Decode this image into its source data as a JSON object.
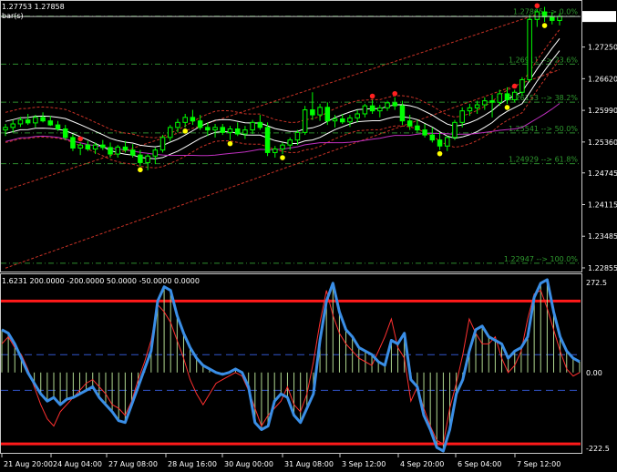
{
  "colors": {
    "background": "#000000",
    "frame": "#c8c8c8",
    "candle_up": "#00ff00",
    "candle_down_fill": "#000000",
    "fib_line": "#2e8b2e",
    "ma_white": "#ffffff",
    "envelope_red": "#c83226",
    "ma_magenta": "#c030c0",
    "trend_red": "#c83226",
    "signal_red": "#ff2020",
    "signal_yellow": "#ffff00",
    "cci_line": "#3a8ee6",
    "cci_signal": "#ff3030",
    "cci_hist": "#b0d890",
    "cci_level_red": "#ff1a1a",
    "cci_dash": "#3355cc",
    "price_box_bg": "#ffffff",
    "price_box_fg": "#000000"
  },
  "header": {
    "price_line": "1.27753 1.27858",
    "sub_label": "bar(s)"
  },
  "current_price": {
    "value": 1.27858,
    "label": "1.27858"
  },
  "price_axis": {
    "min": 1.228,
    "max": 1.2815,
    "ticks": [
      "1.27250",
      "1.26620",
      "1.25990",
      "1.25360",
      "1.24745",
      "1.24115",
      "1.23485",
      "1.22855"
    ],
    "tick_values": [
      1.2725,
      1.2662,
      1.2599,
      1.2536,
      1.24745,
      1.24115,
      1.23485,
      1.22855
    ]
  },
  "fib_levels": [
    {
      "price": 1.27865,
      "label": "1.27865 --> 0.0%"
    },
    {
      "price": 1.26911,
      "label": "1.26911 --> 23.6%"
    },
    {
      "price": 1.26153,
      "label": "1.26153 --> 38.2%"
    },
    {
      "price": 1.25541,
      "label": "1.25541 --> 50.0%"
    },
    {
      "price": 1.24929,
      "label": "1.24929 --> 61.8%"
    },
    {
      "price": 1.22947,
      "label": "1.22947 --> 100.0%"
    }
  ],
  "indicator": {
    "header": "1.6231 200.0000 -200.0000 50.0000 -50.0000 0.0000",
    "axis": {
      "min": -222.5,
      "max": 272.5,
      "ticks": [
        "272.5",
        "0.00",
        "-222.5"
      ],
      "tick_values": [
        272.5,
        0,
        -222.5
      ]
    },
    "levels_red": [
      200,
      -200
    ],
    "levels_dash": [
      50,
      -50
    ],
    "cci": [
      120,
      110,
      80,
      40,
      0,
      -30,
      -60,
      -80,
      -70,
      -90,
      -75,
      -70,
      -60,
      -50,
      -40,
      -70,
      -90,
      -110,
      -135,
      -140,
      -90,
      -40,
      10,
      60,
      200,
      240,
      230,
      160,
      110,
      70,
      40,
      20,
      10,
      0,
      -5,
      0,
      10,
      0,
      -40,
      -140,
      -160,
      -150,
      -80,
      -60,
      -70,
      -120,
      -140,
      -100,
      -60,
      90,
      200,
      250,
      170,
      120,
      100,
      70,
      60,
      50,
      30,
      20,
      90,
      80,
      110,
      -20,
      -40,
      -120,
      -160,
      -210,
      -220,
      -160,
      -60,
      -20,
      60,
      120,
      130,
      100,
      90,
      80,
      40,
      60,
      70,
      100,
      210,
      250,
      260,
      170,
      100,
      60,
      40,
      30
    ],
    "signal": [
      80,
      100,
      70,
      50,
      10,
      -40,
      -90,
      -130,
      -150,
      -110,
      -90,
      -70,
      -50,
      -30,
      -20,
      -40,
      -60,
      -90,
      -100,
      -120,
      -80,
      -20,
      30,
      90,
      190,
      170,
      140,
      90,
      40,
      -20,
      -60,
      -90,
      -60,
      -30,
      -20,
      -10,
      0,
      -10,
      -50,
      -100,
      -150,
      -120,
      -100,
      -80,
      -40,
      -90,
      -110,
      -60,
      30,
      140,
      230,
      160,
      110,
      80,
      60,
      40,
      30,
      20,
      60,
      100,
      150,
      70,
      40,
      -80,
      -40,
      -100,
      -150,
      -190,
      -200,
      -100,
      -30,
      50,
      150,
      110,
      80,
      80,
      100,
      40,
      0,
      20,
      60,
      150,
      220,
      230,
      180,
      120,
      60,
      10,
      -10,
      0
    ]
  },
  "time_axis": {
    "labels": [
      "21 Aug 20:00",
      "24 Aug 04:00",
      "27 Aug 08:00",
      "28 Aug 16:00",
      "30 Aug 00:00",
      "31 Aug 08:00",
      "3 Sep 12:00",
      "4 Sep 20:00",
      "6 Sep 04:00",
      "7 Sep 12:00"
    ]
  },
  "chart_data": {
    "type": "candlestick",
    "title": "",
    "ylim": [
      1.228,
      1.2815
    ],
    "candles": [
      [
        1.256,
        1.2572,
        1.2548,
        1.2565
      ],
      [
        1.2565,
        1.258,
        1.2555,
        1.2572
      ],
      [
        1.2572,
        1.2586,
        1.2566,
        1.258
      ],
      [
        1.258,
        1.2592,
        1.257,
        1.2574
      ],
      [
        1.2574,
        1.259,
        1.2565,
        1.2585
      ],
      [
        1.2585,
        1.2595,
        1.2575,
        1.2578
      ],
      [
        1.2578,
        1.2588,
        1.2568,
        1.257
      ],
      [
        1.257,
        1.2578,
        1.2558,
        1.2562
      ],
      [
        1.2562,
        1.257,
        1.254,
        1.2545
      ],
      [
        1.2545,
        1.2552,
        1.2518,
        1.2524
      ],
      [
        1.2524,
        1.2535,
        1.251,
        1.253
      ],
      [
        1.253,
        1.2538,
        1.2518,
        1.2522
      ],
      [
        1.2522,
        1.2535,
        1.2512,
        1.253
      ],
      [
        1.253,
        1.254,
        1.252,
        1.2525
      ],
      [
        1.2525,
        1.2535,
        1.2505,
        1.2512
      ],
      [
        1.2512,
        1.253,
        1.2505,
        1.2526
      ],
      [
        1.2526,
        1.2538,
        1.2515,
        1.252
      ],
      [
        1.252,
        1.2532,
        1.2505,
        1.251
      ],
      [
        1.251,
        1.252,
        1.2488,
        1.2495
      ],
      [
        1.2495,
        1.2512,
        1.248,
        1.2508
      ],
      [
        1.2508,
        1.2525,
        1.2492,
        1.252
      ],
      [
        1.252,
        1.255,
        1.2515,
        1.2545
      ],
      [
        1.2545,
        1.257,
        1.2538,
        1.2565
      ],
      [
        1.2565,
        1.2582,
        1.2555,
        1.2575
      ],
      [
        1.2575,
        1.2592,
        1.2565,
        1.2585
      ],
      [
        1.2585,
        1.26,
        1.257,
        1.2578
      ],
      [
        1.2578,
        1.259,
        1.256,
        1.2565
      ],
      [
        1.2565,
        1.2575,
        1.2548,
        1.256
      ],
      [
        1.256,
        1.2572,
        1.2545,
        1.2565
      ],
      [
        1.2565,
        1.2572,
        1.255,
        1.2555
      ],
      [
        1.2555,
        1.2568,
        1.254,
        1.2562
      ],
      [
        1.2562,
        1.2575,
        1.2548,
        1.2552
      ],
      [
        1.2552,
        1.2568,
        1.2542,
        1.256
      ],
      [
        1.256,
        1.258,
        1.2552,
        1.2575
      ],
      [
        1.2575,
        1.259,
        1.256,
        1.2565
      ],
      [
        1.2565,
        1.2575,
        1.2508,
        1.2515
      ],
      [
        1.2515,
        1.2528,
        1.2505,
        1.2522
      ],
      [
        1.2522,
        1.2535,
        1.2512,
        1.253
      ],
      [
        1.253,
        1.2545,
        1.252,
        1.254
      ],
      [
        1.254,
        1.256,
        1.253,
        1.2555
      ],
      [
        1.2555,
        1.2608,
        1.255,
        1.26
      ],
      [
        1.26,
        1.2635,
        1.258,
        1.259
      ],
      [
        1.259,
        1.2612,
        1.2578,
        1.2605
      ],
      [
        1.2605,
        1.2615,
        1.257,
        1.2578
      ],
      [
        1.2578,
        1.259,
        1.2565,
        1.2582
      ],
      [
        1.2582,
        1.2592,
        1.2572,
        1.2576
      ],
      [
        1.2576,
        1.259,
        1.2566,
        1.2584
      ],
      [
        1.2584,
        1.26,
        1.2575,
        1.2592
      ],
      [
        1.2592,
        1.2612,
        1.2585,
        1.2608
      ],
      [
        1.2608,
        1.262,
        1.2592,
        1.2598
      ],
      [
        1.2598,
        1.261,
        1.2585,
        1.2604
      ],
      [
        1.2604,
        1.2618,
        1.2598,
        1.2614
      ],
      [
        1.2614,
        1.2625,
        1.26,
        1.2608
      ],
      [
        1.2608,
        1.2618,
        1.257,
        1.2578
      ],
      [
        1.2578,
        1.259,
        1.256,
        1.2568
      ],
      [
        1.2568,
        1.258,
        1.2555,
        1.256
      ],
      [
        1.256,
        1.2572,
        1.2545,
        1.255
      ],
      [
        1.255,
        1.2565,
        1.2535,
        1.254
      ],
      [
        1.254,
        1.2555,
        1.252,
        1.2528
      ],
      [
        1.2528,
        1.2548,
        1.2518,
        1.2545
      ],
      [
        1.2545,
        1.258,
        1.254,
        1.2575
      ],
      [
        1.2575,
        1.2605,
        1.2565,
        1.2598
      ],
      [
        1.2598,
        1.2612,
        1.2588,
        1.2604
      ],
      [
        1.2604,
        1.2618,
        1.2592,
        1.261
      ],
      [
        1.261,
        1.2625,
        1.26,
        1.2618
      ],
      [
        1.2618,
        1.263,
        1.2585,
        1.2615
      ],
      [
        1.2615,
        1.264,
        1.2608,
        1.2632
      ],
      [
        1.2632,
        1.2645,
        1.2612,
        1.262
      ],
      [
        1.262,
        1.264,
        1.2615,
        1.2635
      ],
      [
        1.2635,
        1.2665,
        1.2628,
        1.266
      ],
      [
        1.266,
        1.279,
        1.2655,
        1.278
      ],
      [
        1.278,
        1.28,
        1.2765,
        1.2795
      ],
      [
        1.2795,
        1.2805,
        1.2775,
        1.2785
      ],
      [
        1.2785,
        1.2795,
        1.277,
        1.2778
      ],
      [
        1.2778,
        1.2792,
        1.2768,
        1.2786
      ]
    ]
  }
}
